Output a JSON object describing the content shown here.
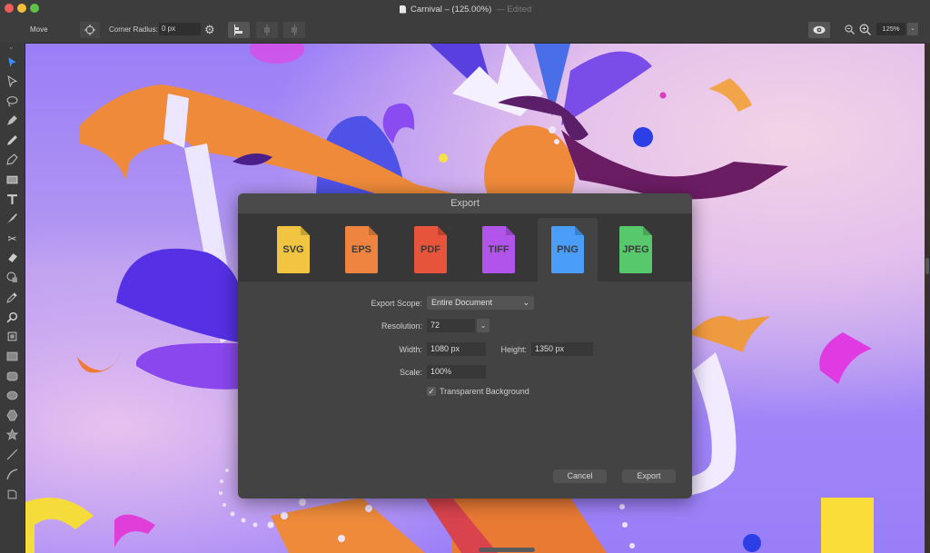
{
  "window": {
    "title": "Carnival – (125.00%)",
    "status": "— Edited"
  },
  "toolbar": {
    "current_tool": "Move",
    "corner_radius_label": "Corner Radius:",
    "corner_radius_value": "0 px",
    "zoom_value": "125%"
  },
  "tools": [
    "selection-arrow",
    "direct-selection",
    "lasso",
    "pen",
    "pencil",
    "brush",
    "fill",
    "text",
    "knife",
    "scissors",
    "eraser",
    "shape-builder",
    "eyedropper",
    "zoom",
    "artboard",
    "rectangle",
    "rounded-rectangle",
    "ellipse",
    "polygon",
    "star",
    "line",
    "arc",
    "crop"
  ],
  "export_dialog": {
    "title": "Export",
    "formats": [
      {
        "label": "SVG",
        "color": "#f1c542"
      },
      {
        "label": "EPS",
        "color": "#ee8440"
      },
      {
        "label": "PDF",
        "color": "#e8533b"
      },
      {
        "label": "TIFF",
        "color": "#b155ea"
      },
      {
        "label": "PNG",
        "color": "#4a9df8"
      },
      {
        "label": "JPEG",
        "color": "#57c96c"
      }
    ],
    "selected_format": "PNG",
    "export_scope_label": "Export Scope:",
    "export_scope_value": "Entire Document",
    "resolution_label": "Resolution:",
    "resolution_value": "72",
    "width_label": "Width:",
    "width_value": "1080 px",
    "height_label": "Height:",
    "height_value": "1350 px",
    "scale_label": "Scale:",
    "scale_value": "100%",
    "transparent_bg_label": "Transparent Background",
    "transparent_bg_checked": true,
    "cancel_label": "Cancel",
    "export_label": "Export"
  }
}
